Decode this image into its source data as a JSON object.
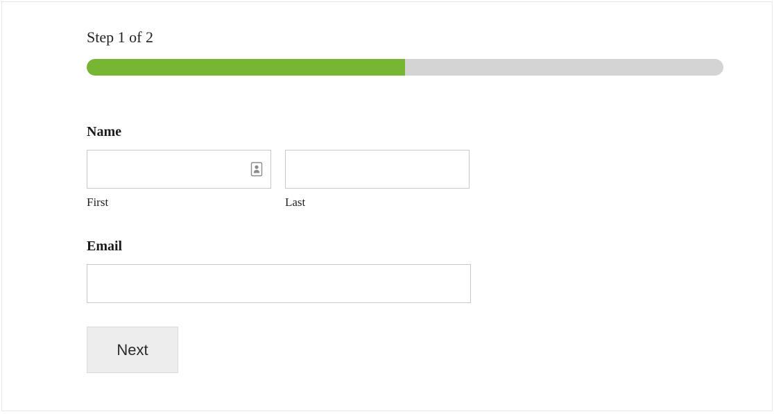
{
  "progress": {
    "label": "Step 1 of 2",
    "percent": 50
  },
  "fields": {
    "name": {
      "label": "Name",
      "first": {
        "sublabel": "First",
        "value": ""
      },
      "last": {
        "sublabel": "Last",
        "value": ""
      }
    },
    "email": {
      "label": "Email",
      "value": ""
    }
  },
  "buttons": {
    "next": "Next"
  }
}
